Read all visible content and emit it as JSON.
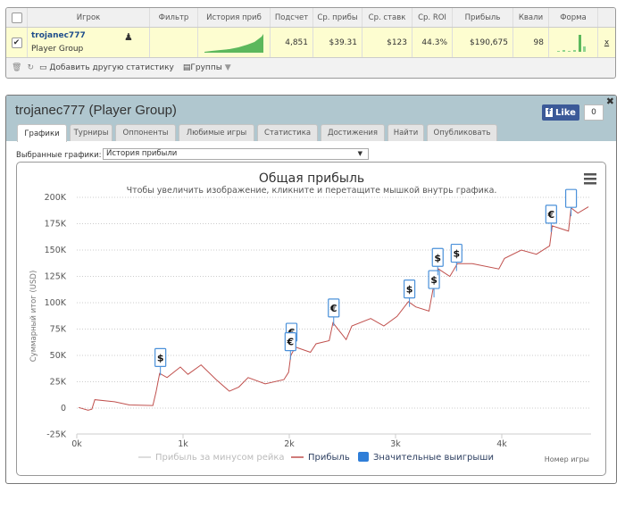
{
  "table": {
    "headers": [
      "Игрок",
      "Фильтр",
      "История приб",
      "Подсчет",
      "Ср. прибы",
      "Ср. ставк",
      "Ср. ROI",
      "Прибыль",
      "Квали",
      "Форма"
    ],
    "row": {
      "checked": true,
      "player": "trojanec777",
      "group": "Player Group",
      "count": "4,851",
      "avg_profit": "$39.31",
      "avg_stake": "$123",
      "avg_roi": "44.3%",
      "profit": "$190,675",
      "qual": "98",
      "remove": "x"
    },
    "footer": {
      "add_stat": "Добавить другую статистику",
      "groups": "Группы"
    }
  },
  "modal": {
    "title": "trojanec777 (Player Group)",
    "like": {
      "label": "Like",
      "count": "0"
    },
    "tabs": [
      "Графики",
      "Турниры",
      "Оппоненты",
      "Любимые игры",
      "Статистика",
      "Достижения",
      "Найти",
      "Опубликовать"
    ],
    "active_tab": 0,
    "select_label": "Выбранные графики:",
    "select_value": "История прибыли"
  },
  "colors": {
    "profit_line": "#c0504d",
    "accent": "#2f7ed8",
    "header": "#b0c7cf",
    "row_highlight": "#fdfdd0",
    "sparkline": "#5cb85c"
  },
  "chart_data": {
    "type": "line",
    "title": "Общая прибыль",
    "subtitle": "Чтобы увеличить изображение, кликните и перетащите мышкой внутрь графика.",
    "ylabel": "Суммарный итог (USD)",
    "xlabel": "Номер игры",
    "ylim": [
      -25000,
      200000
    ],
    "xlim": [
      0,
      4900
    ],
    "yticks": [
      "-25K",
      "0",
      "25K",
      "50K",
      "75K",
      "100K",
      "125K",
      "150K",
      "175K",
      "200K"
    ],
    "ytick_values": [
      -25000,
      0,
      25000,
      50000,
      75000,
      100000,
      125000,
      150000,
      175000,
      200000
    ],
    "xticks": [
      "0k",
      "1k",
      "2k",
      "3k",
      "4k"
    ],
    "xtick_values": [
      0,
      1000,
      2000,
      3000,
      4000
    ],
    "grid": true,
    "legend": [
      "Прибыль за минусом рейка",
      "Прибыль",
      "Значительные выигрыши"
    ],
    "legend_placement": "bottom",
    "series": [
      {
        "name": "Прибыль",
        "x": [
          18,
          106,
          142,
          170,
          355,
          496,
          716,
          745,
          780,
          850,
          975,
          1046,
          1170,
          1312,
          1436,
          1525,
          1613,
          1773,
          1950,
          1993,
          2014,
          2057,
          2199,
          2252,
          2376,
          2411,
          2535,
          2589,
          2766,
          2890,
          3014,
          3121,
          3191,
          3315,
          3351,
          3404,
          3511,
          3582,
          3723,
          3972,
          4025,
          4184,
          4326,
          4450,
          4475,
          4628,
          4652,
          4716,
          4816
        ],
        "y": [
          600,
          -2000,
          -1000,
          8000,
          6000,
          3000,
          2500,
          15000,
          33000,
          29000,
          39000,
          32000,
          41000,
          27000,
          16000,
          20000,
          29000,
          23000,
          27000,
          34000,
          50000,
          58000,
          53000,
          61000,
          64000,
          81000,
          65000,
          78000,
          85000,
          78000,
          87000,
          101000,
          96000,
          92000,
          112000,
          132000,
          125000,
          137000,
          137000,
          132000,
          142000,
          150000,
          146000,
          154000,
          173000,
          168000,
          190000,
          185000,
          191000
        ]
      }
    ],
    "flags": [
      {
        "x": 787,
        "y": 48000,
        "symbol": "$"
      },
      {
        "x": 2021,
        "y": 72000,
        "symbol": "€"
      },
      {
        "x": 2011,
        "y": 63000,
        "symbol": "€"
      },
      {
        "x": 2418,
        "y": 95000,
        "symbol": "€"
      },
      {
        "x": 3131,
        "y": 113000,
        "symbol": "$"
      },
      {
        "x": 3362,
        "y": 122000,
        "symbol": "$"
      },
      {
        "x": 3397,
        "y": 143000,
        "symbol": "$"
      },
      {
        "x": 3574,
        "y": 147000,
        "symbol": "$"
      },
      {
        "x": 4465,
        "y": 184000,
        "symbol": "€"
      },
      {
        "x": 4652,
        "y": 199000,
        "symbol": ""
      }
    ]
  }
}
